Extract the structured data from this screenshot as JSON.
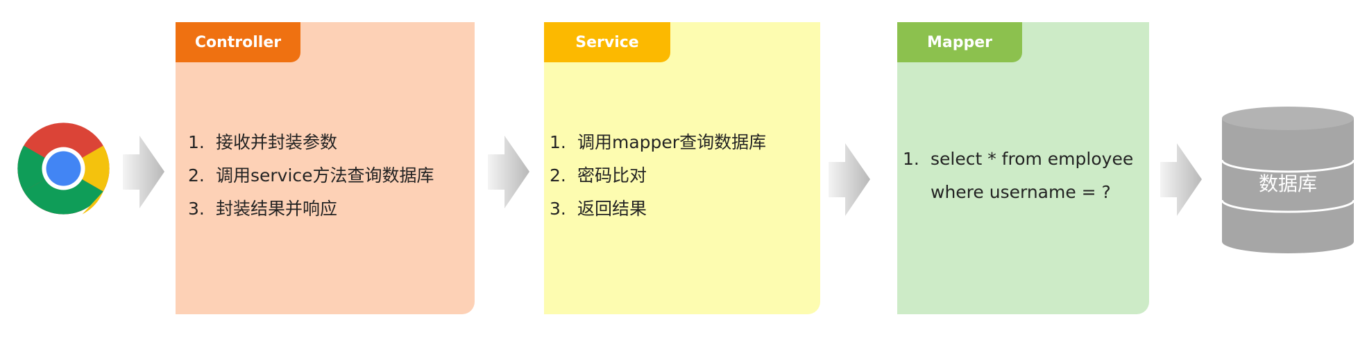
{
  "browser": {
    "icon": "chrome-browser-icon"
  },
  "cards": {
    "controller": {
      "title": "Controller",
      "accent": "#ef7111",
      "background": "#fdd1b6",
      "items": [
        {
          "num": "1.",
          "text": "接收并封装参数"
        },
        {
          "num": "2.",
          "text": "调用service方法查询数据库"
        },
        {
          "num": "3.",
          "text": "封装结果并响应"
        }
      ]
    },
    "service": {
      "title": "Service",
      "accent": "#fcb900",
      "background": "#fdfcb0",
      "items": [
        {
          "num": "1.",
          "text": "调用mapper查询数据库"
        },
        {
          "num": "2.",
          "text": "密码比对"
        },
        {
          "num": "3.",
          "text": "返回结果"
        }
      ]
    },
    "mapper": {
      "title": "Mapper",
      "accent": "#8cc14e",
      "background": "#cdebc7",
      "items": [
        {
          "num": "1.",
          "text": "select * from employee\nwhere username = ?"
        }
      ]
    }
  },
  "database": {
    "label": "数据库",
    "color": "#a6a6a6"
  }
}
